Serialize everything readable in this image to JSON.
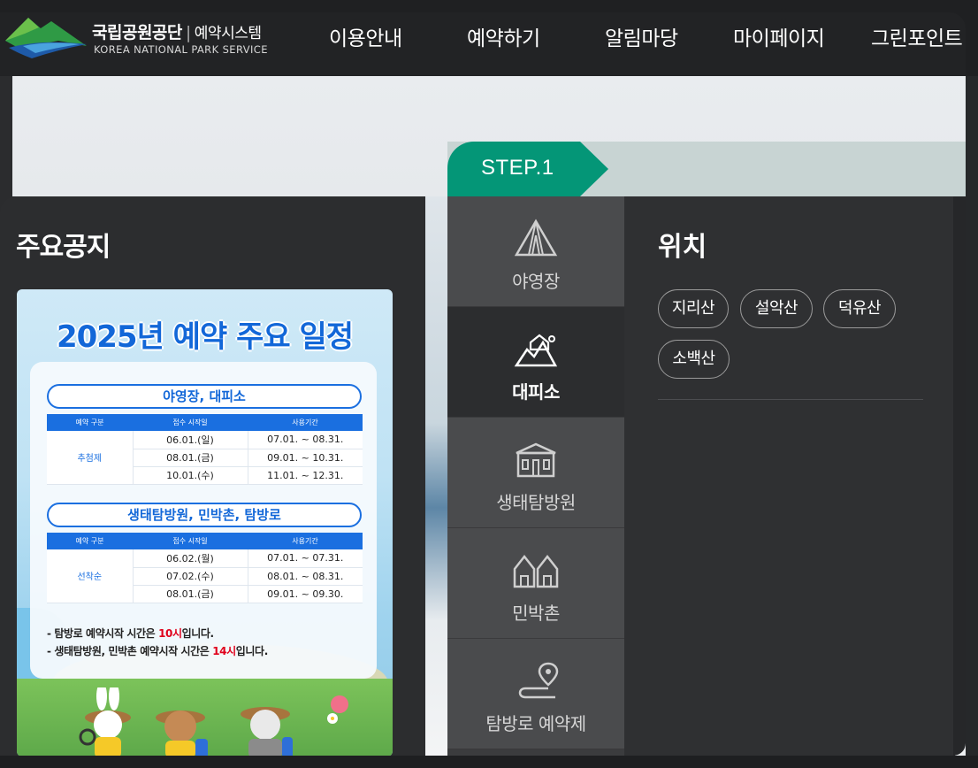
{
  "header": {
    "logo_ko": "국립공원공단",
    "logo_system": "예약시스템",
    "logo_en": "KOREA NATIONAL PARK SERVICE",
    "nav": [
      "이용안내",
      "예약하기",
      "알림마당",
      "마이페이지",
      "그린포인트"
    ]
  },
  "step": {
    "label": "STEP.1"
  },
  "notice": {
    "title": "주요공지",
    "poster": {
      "title": "2025년 예약 주요 일정",
      "section1": {
        "heading": "야영장, 대피소",
        "columns": [
          "예약 구분",
          "접수 시작일",
          "사용기간"
        ],
        "group": "추첨제",
        "rows": [
          [
            "06.01.(일)",
            "07.01. ~ 08.31."
          ],
          [
            "08.01.(금)",
            "09.01. ~ 10.31."
          ],
          [
            "10.01.(수)",
            "11.01. ~ 12.31."
          ]
        ]
      },
      "section2": {
        "heading": "생태탐방원, 민박촌, 탐방로",
        "columns": [
          "예약 구분",
          "접수 시작일",
          "사용기간"
        ],
        "group": "선착순",
        "rows": [
          [
            "06.02.(월)",
            "07.01. ~ 07.31."
          ],
          [
            "07.02.(수)",
            "08.01. ~ 08.31."
          ],
          [
            "08.01.(금)",
            "09.01. ~ 09.30."
          ]
        ]
      },
      "note1_prefix": "- 탐방로 예약시작 시간은 ",
      "note1_time": "10시",
      "note1_suffix": "입니다.",
      "note2_prefix": "- 생태탐방원, 민박촌 예약시작 시간은 ",
      "note2_time": "14시",
      "note2_suffix": "입니다."
    }
  },
  "categories": [
    {
      "label": "야영장",
      "icon": "tent-icon",
      "active": false
    },
    {
      "label": "대피소",
      "icon": "shelter-icon",
      "active": true
    },
    {
      "label": "생태탐방원",
      "icon": "eco-center-icon",
      "active": false
    },
    {
      "label": "민박촌",
      "icon": "village-icon",
      "active": false
    },
    {
      "label": "탐방로 예약제",
      "icon": "trail-pin-icon",
      "active": false
    }
  ],
  "location": {
    "title": "위치",
    "options": [
      "지리산",
      "설악산",
      "덕유산",
      "소백산"
    ]
  },
  "colors": {
    "accent_green": "#049677",
    "poster_blue": "#1a6fe0",
    "highlight_red": "#e0001b"
  }
}
